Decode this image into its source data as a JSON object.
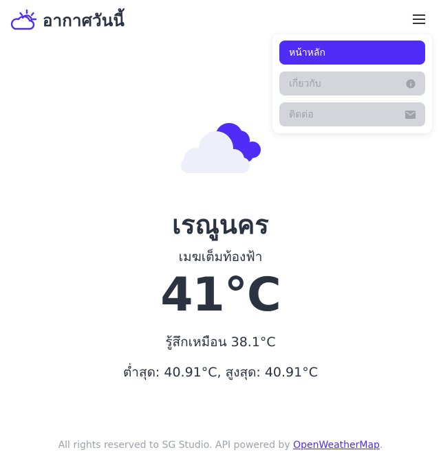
{
  "app": {
    "title": "อากาศวันนี้",
    "brand_icon": "sun-cloud-icon",
    "menu_icon": "hamburger-menu-icon"
  },
  "menu": {
    "items": [
      {
        "label": "หน้าหลัก",
        "active": true,
        "icon": ""
      },
      {
        "label": "เกี่ยวกับ",
        "active": false,
        "icon": "info-icon"
      },
      {
        "label": "ติดต่อ",
        "active": false,
        "icon": "mail-icon"
      }
    ]
  },
  "weather": {
    "icon": "cloud-icon",
    "city": "เรณูนคร",
    "condition": "เมฆเต็มท้องฟ้า",
    "temperature": "41°C",
    "feels_like": "รู้สึกเหมือน 38.1°C",
    "min_max": "ต่ำสุด: 40.91°C, สูงสุด: 40.91°C"
  },
  "footer": {
    "text": "All rights reserved to SG Studio. API powered by ",
    "link_text": "OpenWeatherMap",
    "suffix": "."
  },
  "colors": {
    "accent": "#4f2df7",
    "text": "#2b3240",
    "muted": "#9ea2ab",
    "inactive_bg": "#d4d5da",
    "cloud_light": "#eeeffb"
  }
}
